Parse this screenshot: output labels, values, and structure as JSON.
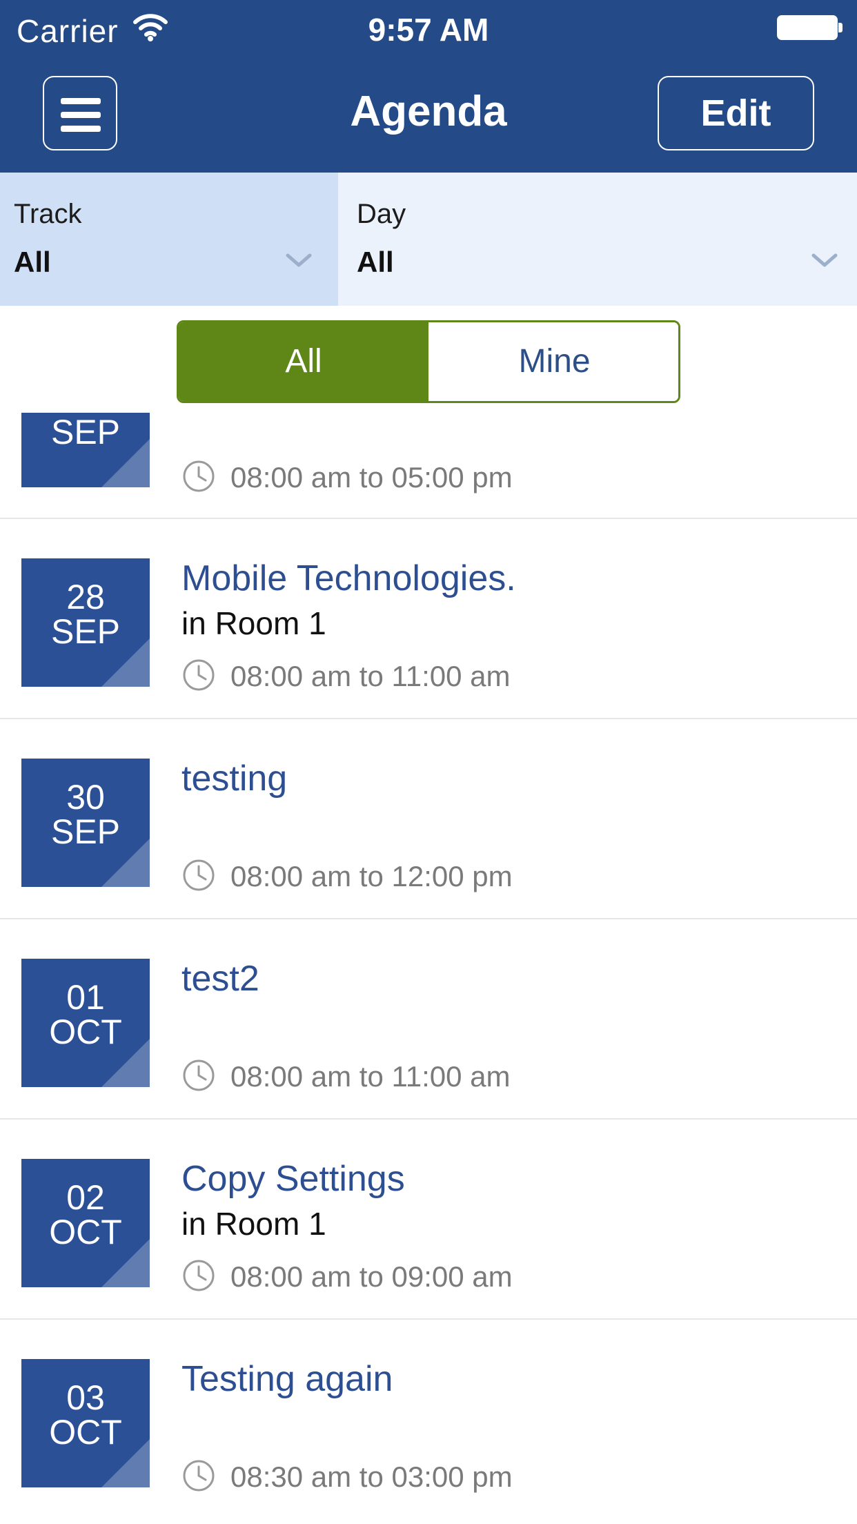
{
  "status_bar": {
    "carrier": "Carrier",
    "time": "9:57 AM"
  },
  "nav": {
    "title": "Agenda",
    "edit_label": "Edit"
  },
  "filters": {
    "track": {
      "label": "Track",
      "value": "All"
    },
    "day": {
      "label": "Day",
      "value": "All"
    }
  },
  "segment": {
    "all_label": "All",
    "mine_label": "Mine",
    "selected": "All"
  },
  "sessions": [
    {
      "day": "",
      "month": "SEP",
      "title": "",
      "room": "",
      "time": "08:00 am to 05:00 pm"
    },
    {
      "day": "28",
      "month": "SEP",
      "title": "Mobile Technologies.",
      "room": "in Room 1",
      "time": "08:00 am to 11:00 am"
    },
    {
      "day": "30",
      "month": "SEP",
      "title": "testing",
      "room": "",
      "time": "08:00 am to 12:00 pm"
    },
    {
      "day": "01",
      "month": "OCT",
      "title": "test2",
      "room": "",
      "time": "08:00 am to 11:00 am"
    },
    {
      "day": "02",
      "month": "OCT",
      "title": "Copy Settings",
      "room": "in Room 1",
      "time": "08:00 am to 09:00 am"
    },
    {
      "day": "03",
      "month": "OCT",
      "title": "Testing again",
      "room": "",
      "time": "08:30 am to 03:00 pm"
    }
  ],
  "colors": {
    "nav_bg": "#244b87",
    "accent_green": "#5f8717",
    "date_box": "#2c5096",
    "title_blue": "#2d4f91",
    "track_filter_bg": "#cfdff5",
    "day_filter_bg": "#ebf2fb"
  }
}
